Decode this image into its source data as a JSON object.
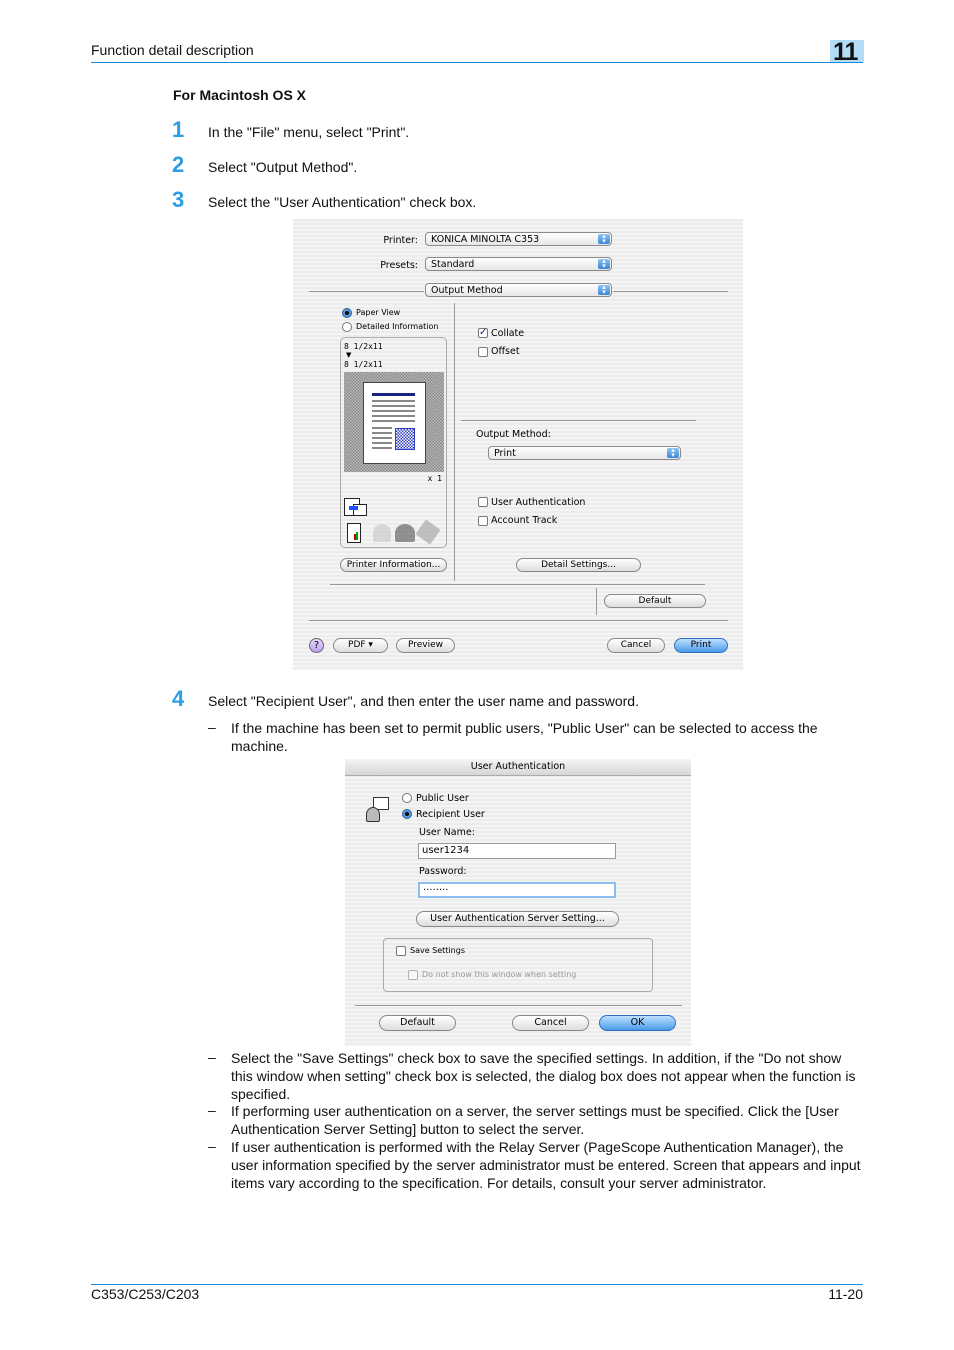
{
  "header": {
    "section": "Function detail description",
    "chapter": "11"
  },
  "section_title": "For Macintosh OS X",
  "steps": [
    {
      "num": "1",
      "text": "In the \"File\" menu, select \"Print\"."
    },
    {
      "num": "2",
      "text": "Select \"Output Method\"."
    },
    {
      "num": "3",
      "text": "Select the \"User Authentication\" check box."
    },
    {
      "num": "4",
      "text": "Select \"Recipient User\", and then enter the user name and password."
    }
  ],
  "notes_step4": [
    "If the machine has been set to permit public users, \"Public User\" can be selected to access the machine.",
    "Select the \"Save Settings\" check box to save the specified settings. In addition, if the \"Do not show this window when setting\" check box is selected, the dialog box does not appear when the function is specified.",
    "If performing user authentication on a server, the server settings must be specified. Click the [User Authentication Server Setting] button to select the server.",
    "If user authentication is performed with the Relay Server (PageScope Authentication Manager), the user information specified by the server administrator must be entered. Screen that appears and input items vary according to the specification. For details, consult your server administrator."
  ],
  "dash": "–",
  "print_dialog": {
    "printer_label": "Printer:",
    "printer_value": "KONICA MINOLTA C353",
    "presets_label": "Presets:",
    "presets_value": "Standard",
    "panel_value": "Output Method",
    "view_options": [
      {
        "label": "Paper View",
        "selected": true
      },
      {
        "label": "Detailed Information",
        "selected": false
      }
    ],
    "paper_from": "8 1/2x11",
    "paper_arrow": "▼",
    "paper_to": "8 1/2x11",
    "copies": "x 1",
    "collate_label": "Collate",
    "collate_checked": true,
    "offset_label": "Offset",
    "offset_checked": false,
    "output_method_label": "Output Method:",
    "output_method_value": "Print",
    "user_auth_label": "User Authentication",
    "user_auth_checked": false,
    "account_track_label": "Account Track",
    "account_track_checked": false,
    "printer_info_button": "Printer Information...",
    "detail_settings_button": "Detail Settings...",
    "default_button": "Default",
    "help_button": "?",
    "pdf_button": "PDF ▾",
    "preview_button": "Preview",
    "cancel_button": "Cancel",
    "print_button": "Print",
    "check_glyph": "✓"
  },
  "auth_dialog": {
    "title": "User Authentication",
    "options": [
      {
        "label": "Public User",
        "selected": false
      },
      {
        "label": "Recipient User",
        "selected": true
      }
    ],
    "username_label": "User Name:",
    "username_value": "user1234",
    "password_label": "Password:",
    "password_value": "········",
    "server_button": "User Authentication Server Setting...",
    "save_settings_label": "Save Settings",
    "save_settings_checked": false,
    "dont_show_label": "Do not show this window when setting",
    "dont_show_checked": false,
    "default_button": "Default",
    "cancel_button": "Cancel",
    "ok_button": "OK"
  },
  "footer": {
    "model": "C353/C253/C203",
    "page": "11-20"
  }
}
